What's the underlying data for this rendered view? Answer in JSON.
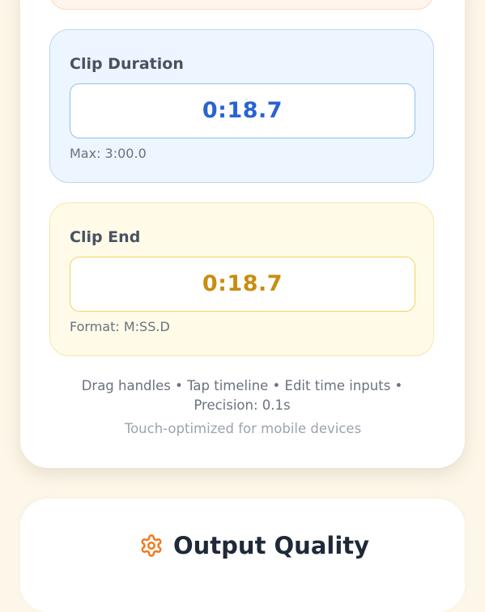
{
  "clip_duration": {
    "label": "Clip Duration",
    "value": "0:18.7",
    "hint": "Max: 3:00.0"
  },
  "clip_end": {
    "label": "Clip End",
    "value": "0:18.7",
    "hint": "Format: M:SS.D"
  },
  "instructions": "Drag handles • Tap timeline • Edit time inputs • Precision: 0.1s",
  "touch_note": "Touch-optimized for mobile devices",
  "output_quality": {
    "title": "Output Quality",
    "icon": "gear-icon"
  },
  "colors": {
    "duration_accent": "#2a63d2",
    "end_accent": "#c98d10",
    "gear_icon": "#f07a1e"
  }
}
